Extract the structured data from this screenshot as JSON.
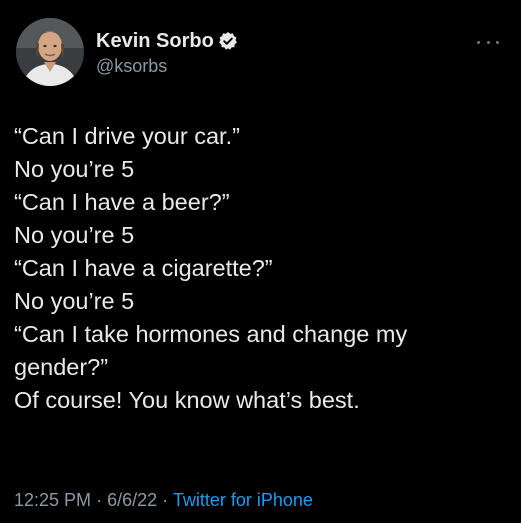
{
  "author": {
    "display_name": "Kevin Sorbo",
    "handle": "@ksorbs",
    "verified": true,
    "avatar_icon": "profile-photo"
  },
  "tweet": {
    "lines": [
      "“Can I drive your car.”",
      "No you’re 5",
      "“Can I have a beer?”",
      "No you’re 5",
      "“Can I have a cigarette?”",
      "No you’re 5",
      "“Can I take hormones and change my",
      "gender?”",
      "Of course! You know what’s best."
    ]
  },
  "meta": {
    "time": "12:25 PM",
    "separator": "·",
    "date": "6/6/22",
    "source": "Twitter for iPhone"
  },
  "icons": {
    "verified": "verified-badge-icon",
    "more": "more-options-icon"
  },
  "colors": {
    "background": "#000000",
    "text": "#e7e9ea",
    "secondary": "#8b98a5",
    "link": "#1d9bf0"
  }
}
